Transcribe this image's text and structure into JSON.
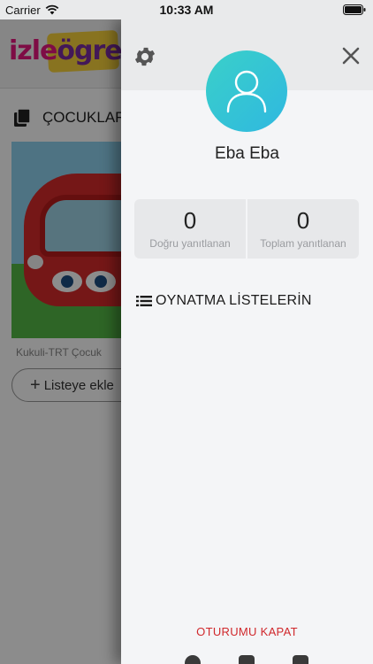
{
  "status_bar": {
    "carrier": "Carrier",
    "time": "10:33 AM"
  },
  "background": {
    "logo_izle": "izle",
    "logo_ogre": "ögre",
    "section_title": "ÇOCUKLAR",
    "video_caption": "Kukuli-TRT Çocuk",
    "add_to_list_label": "Listeye ekle"
  },
  "drawer": {
    "user_name": "Eba Eba",
    "stats": [
      {
        "value": "0",
        "label": "Doğru yanıtlanan"
      },
      {
        "value": "0",
        "label": "Toplam yanıtlanan"
      }
    ],
    "playlists_label": "OYNATMA LİSTELERİN",
    "logout_label": "OTURUMU KAPAT"
  },
  "icons": {
    "settings": "gear-icon",
    "close": "close-icon",
    "avatar": "user-icon",
    "playlists": "list-icon"
  },
  "colors": {
    "avatar_gradient_start": "#3ad0c9",
    "avatar_gradient_end": "#2fb8e0",
    "logout_red": "#d0282c",
    "drawer_bg": "#f4f5f7"
  }
}
